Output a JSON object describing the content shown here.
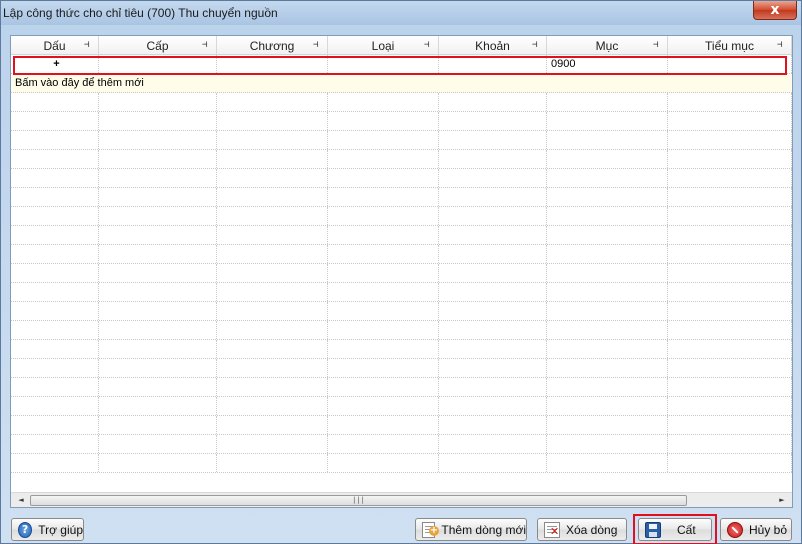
{
  "window": {
    "title": "Lập công thức cho chỉ tiêu (700) Thu chuyển nguồn",
    "close_glyph": "x"
  },
  "grid": {
    "columns": [
      {
        "key": "dau",
        "label": "Dấu"
      },
      {
        "key": "cap",
        "label": "Cấp"
      },
      {
        "key": "chuong",
        "label": "Chương"
      },
      {
        "key": "loai",
        "label": "Loại"
      },
      {
        "key": "khoan",
        "label": "Khoản"
      },
      {
        "key": "muc",
        "label": "Mục"
      },
      {
        "key": "tieu_muc",
        "label": "Tiểu mục"
      }
    ],
    "pin_glyph": "⊣",
    "rows": [
      {
        "dau": "+",
        "cap": "",
        "chuong": "",
        "loai": "",
        "khoan": "",
        "muc": "0900",
        "tieu_muc": ""
      }
    ],
    "new_row_prompt": "Bấm vào đây để thêm mới",
    "scroll_left": "◄",
    "scroll_right": "►",
    "scroll_grip": "|||"
  },
  "buttons": {
    "help": "Trợ giúp",
    "add_row": "Thêm dòng mới",
    "delete_row": "Xóa dòng",
    "save": "Cất",
    "cancel": "Hủy bỏ",
    "help_glyph": "?"
  },
  "colors": {
    "highlight": "#e1101d",
    "new_row_bg": "#fffde9"
  }
}
